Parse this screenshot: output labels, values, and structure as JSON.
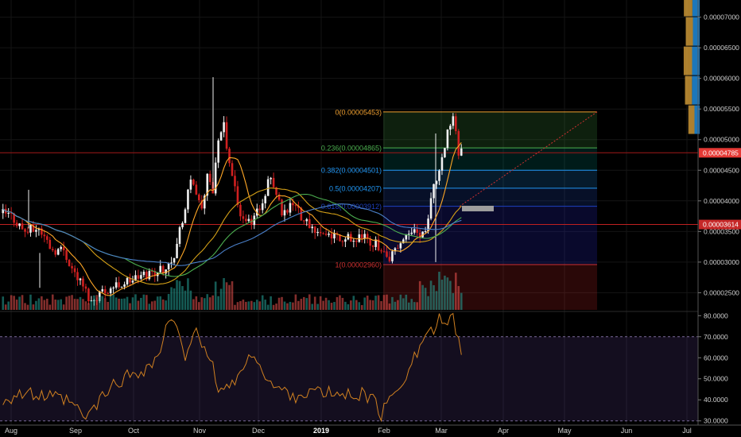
{
  "chart_data": [
    {
      "type": "candlestick",
      "title": "",
      "x_ticks": [
        "Aug",
        "Sep",
        "Oct",
        "Nov",
        "Dec",
        "2019",
        "Feb",
        "Mar",
        "Apr",
        "May",
        "Jun",
        "Jul"
      ],
      "y_ticks": [
        "0.00007000",
        "0.00006500",
        "0.00006000",
        "0.00005500",
        "0.00005000",
        "0.00004500",
        "0.00004000",
        "0.00003500",
        "0.00003000",
        "0.00002500"
      ],
      "ylim": [
        2.22e-05,
        7.28e-05
      ],
      "current_price": "0.00004785",
      "level_tag": "0.00003614",
      "fib_levels": [
        {
          "label": "0(0.00005453)",
          "value": 5.453e-05,
          "color": "#f0a030"
        },
        {
          "label": "0.236(0.00004865)",
          "value": 4.865e-05,
          "color": "#4caf50"
        },
        {
          "label": "0.382(0.00004501)",
          "value": 4.501e-05,
          "color": "#2196f3"
        },
        {
          "label": "0.5(0.00004207)",
          "value": 4.207e-05,
          "color": "#2196f3"
        },
        {
          "label": "0.618(0.00003912)",
          "value": 3.912e-05,
          "color": "#1e40c0"
        },
        {
          "label": "1(0.00002960)",
          "value": 2.96e-05,
          "color": "#d03030"
        }
      ],
      "price_anchors": [
        [
          0,
          3.8
        ],
        [
          3,
          3.75
        ],
        [
          8,
          3.5
        ],
        [
          13,
          3.55
        ],
        [
          18,
          3.2
        ],
        [
          22,
          3.2
        ],
        [
          25,
          2.9
        ],
        [
          29,
          2.6
        ],
        [
          32,
          2.35
        ],
        [
          35,
          2.5
        ],
        [
          40,
          2.6
        ],
        [
          46,
          2.7
        ],
        [
          52,
          2.8
        ],
        [
          58,
          2.9
        ],
        [
          62,
          3.1
        ],
        [
          64,
          3.5
        ],
        [
          66,
          3.9
        ],
        [
          68,
          4.3
        ],
        [
          70,
          4.1
        ],
        [
          72,
          3.8
        ],
        [
          74,
          4.4
        ],
        [
          76,
          4.2
        ],
        [
          78,
          4.9
        ],
        [
          80,
          5.2
        ],
        [
          82,
          4.6
        ],
        [
          84,
          4.2
        ],
        [
          86,
          3.8
        ],
        [
          90,
          3.6
        ],
        [
          94,
          4.0
        ],
        [
          97,
          4.4
        ],
        [
          99,
          4.1
        ],
        [
          101,
          3.85
        ],
        [
          104,
          3.9
        ],
        [
          106,
          4.0
        ],
        [
          108,
          3.75
        ],
        [
          111,
          3.6
        ],
        [
          114,
          3.5
        ],
        [
          118,
          3.45
        ],
        [
          122,
          3.4
        ],
        [
          127,
          3.35
        ],
        [
          131,
          3.4
        ],
        [
          134,
          3.3
        ],
        [
          137,
          3.25
        ],
        [
          139,
          3.0
        ],
        [
          141,
          3.15
        ],
        [
          143,
          3.3
        ],
        [
          145,
          3.4
        ],
        [
          147,
          3.5
        ],
        [
          149,
          3.6
        ],
        [
          151,
          3.4
        ],
        [
          153,
          3.5
        ],
        [
          154,
          3.8
        ],
        [
          156,
          4.3
        ],
        [
          158,
          4.5
        ],
        [
          160,
          4.8
        ],
        [
          161,
          5.1
        ],
        [
          162,
          5.3
        ],
        [
          163,
          5.4
        ],
        [
          164,
          5.1
        ],
        [
          165,
          4.8
        ]
      ],
      "volume_profile_buckets": [
        16,
        15,
        14,
        13,
        12,
        11,
        10,
        9,
        8,
        7,
        6
      ],
      "rsi": {
        "y_ticks": [
          "80.0000",
          "70.0000",
          "60.0000",
          "50.0000",
          "40.0000",
          "30.0000"
        ],
        "ylim": [
          28,
          82
        ],
        "band": [
          30,
          70
        ],
        "anchors": [
          [
            0,
            40
          ],
          [
            6,
            43
          ],
          [
            12,
            42
          ],
          [
            18,
            41
          ],
          [
            24,
            39
          ],
          [
            30,
            31
          ],
          [
            34,
            38
          ],
          [
            40,
            47
          ],
          [
            46,
            52
          ],
          [
            52,
            55
          ],
          [
            56,
            60
          ],
          [
            59,
            73
          ],
          [
            61,
            79
          ],
          [
            63,
            72
          ],
          [
            66,
            60
          ],
          [
            68,
            70
          ],
          [
            70,
            76
          ],
          [
            72,
            66
          ],
          [
            74,
            58
          ],
          [
            76,
            55
          ],
          [
            78,
            46
          ],
          [
            80,
            44
          ],
          [
            84,
            50
          ],
          [
            88,
            56
          ],
          [
            91,
            63
          ],
          [
            93,
            58
          ],
          [
            95,
            50
          ],
          [
            98,
            46
          ],
          [
            102,
            44
          ],
          [
            106,
            42
          ],
          [
            112,
            44
          ],
          [
            118,
            43
          ],
          [
            124,
            42
          ],
          [
            130,
            43
          ],
          [
            134,
            40
          ],
          [
            137,
            33
          ],
          [
            140,
            40
          ],
          [
            143,
            46
          ],
          [
            146,
            52
          ],
          [
            148,
            60
          ],
          [
            150,
            62
          ],
          [
            152,
            68
          ],
          [
            154,
            74
          ],
          [
            156,
            72
          ],
          [
            158,
            78
          ],
          [
            161,
            75
          ],
          [
            163,
            79
          ],
          [
            165,
            70
          ],
          [
            166,
            64
          ]
        ]
      }
    }
  ]
}
